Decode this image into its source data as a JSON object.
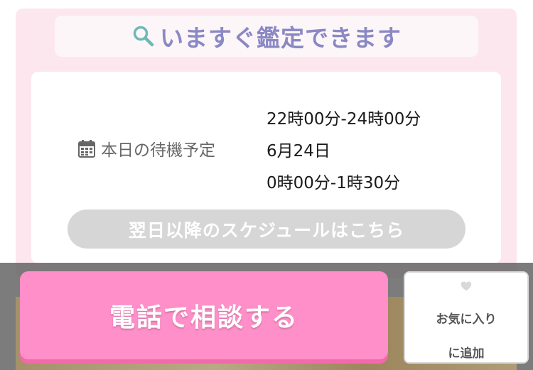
{
  "header": {
    "title": "いますぐ鑑定できます",
    "icon": "search-icon"
  },
  "schedule": {
    "label": "本日の待機予定",
    "icon": "calendar-icon",
    "entries": [
      "22時00分-24時00分",
      "6月24日",
      "0時00分-1時30分"
    ]
  },
  "next_schedule_button": {
    "label": "翌日以降のスケジュールはこちら"
  },
  "bottom_bar": {
    "call_button": {
      "label": "電話で相談する"
    },
    "favorite_button": {
      "line1": "お気に入り",
      "line2": "に追加",
      "icon": "heart-icon"
    }
  },
  "colors": {
    "panel_bg": "#fde7ef",
    "header_text": "#8a88c4",
    "call_button": "#ff8fc9",
    "next_button": "#d6d6d6",
    "heart": "#d9d9d9"
  }
}
